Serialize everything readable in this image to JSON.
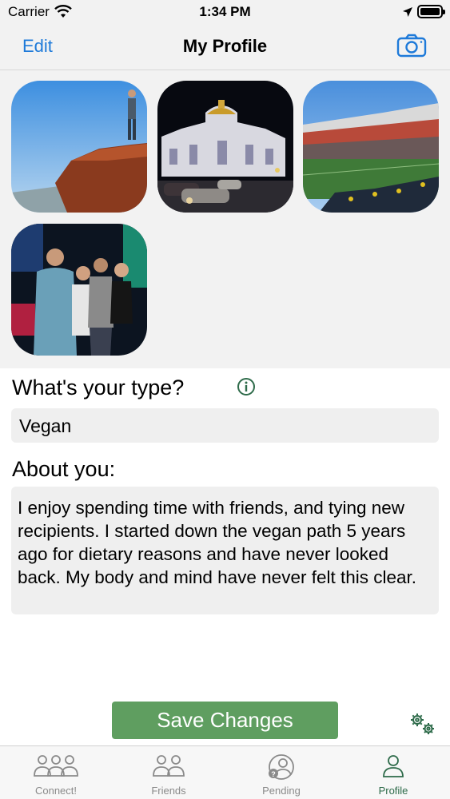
{
  "status_bar": {
    "carrier": "Carrier",
    "time": "1:34 PM"
  },
  "nav": {
    "edit_label": "Edit",
    "title": "My Profile",
    "camera_icon": "camera-icon"
  },
  "photos": [
    {
      "name": "photo-cliff",
      "subject": "person standing on rocky cliff"
    },
    {
      "name": "photo-palace",
      "subject": "illuminated palace at night"
    },
    {
      "name": "photo-stadium",
      "subject": "football stadium"
    },
    {
      "name": "photo-friends",
      "subject": "group of friends at party"
    }
  ],
  "type_section": {
    "label": "What's your type?",
    "value": "Vegan",
    "info_icon": "info-icon"
  },
  "about_section": {
    "label": "About you:",
    "value": "I enjoy spending time with friends, and tying new recipients. I started down the vegan path 5 years ago for dietary reasons and have never looked back. My body and mind have never felt this clear."
  },
  "actions": {
    "save_label": "Save Changes",
    "settings_icon": "gears-icon"
  },
  "tabs": [
    {
      "label": "Connect!",
      "icon": "group-icon",
      "active": false
    },
    {
      "label": "Friends",
      "icon": "two-people-icon",
      "active": false
    },
    {
      "label": "Pending",
      "icon": "pending-person-icon",
      "active": false
    },
    {
      "label": "Profile",
      "icon": "person-icon",
      "active": true
    }
  ],
  "colors": {
    "accent_blue": "#1e7ad9",
    "save_green": "#5f9e60",
    "active_tab": "#2e6b4a",
    "inactive_tab": "#8a8a8a"
  }
}
